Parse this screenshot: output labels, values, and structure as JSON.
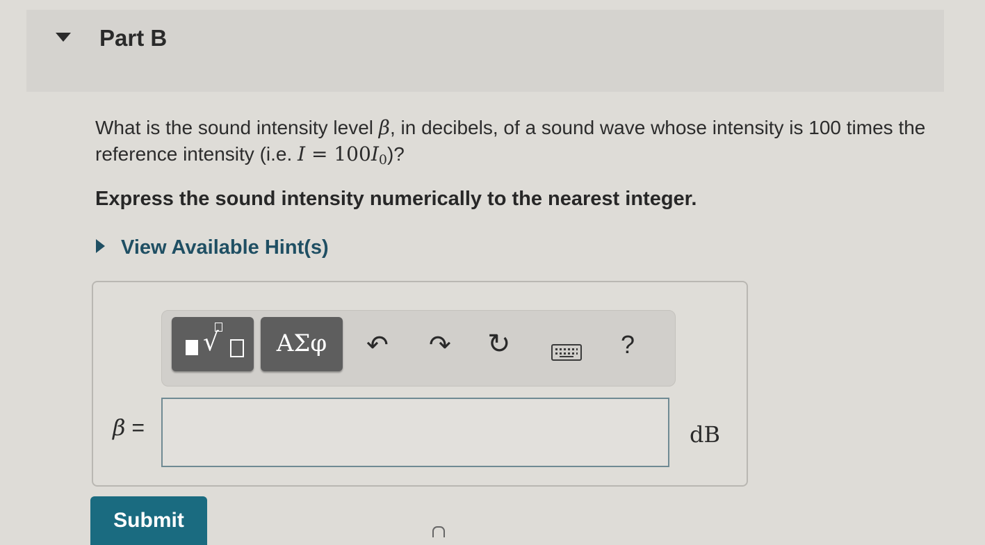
{
  "part": {
    "title": "Part B"
  },
  "question": {
    "text_before": "What is the sound intensity level ",
    "symbol": "β",
    "text_middle": ", in decibels, of a sound wave whose intensity is 100 times the reference intensity (i.e. ",
    "equation_lhs": "I",
    "equation_eq": " = 100",
    "equation_rhs": "I",
    "equation_sub": "0",
    "text_after": ")?"
  },
  "instruction": "Express the sound intensity numerically to the nearest integer.",
  "hint": {
    "label": "View Available Hint(s)"
  },
  "toolbar": {
    "templates_icon": "templates-radical-icon",
    "greek_label": "ΑΣφ",
    "undo_icon": "↶",
    "redo_icon": "↷",
    "reset_icon": "↻",
    "keyboard_icon": "keyboard-icon",
    "help_label": "?"
  },
  "answer": {
    "variable": "β",
    "equals": "=",
    "value": "",
    "unit": "dB"
  },
  "submit": {
    "label": "Submit"
  },
  "colors": {
    "background": "#dedcd7",
    "header_band": "#d5d3cf",
    "toolbar_button": "#5e5e5e",
    "hint_link": "#1f4f63",
    "submit_button": "#1a6b80"
  }
}
